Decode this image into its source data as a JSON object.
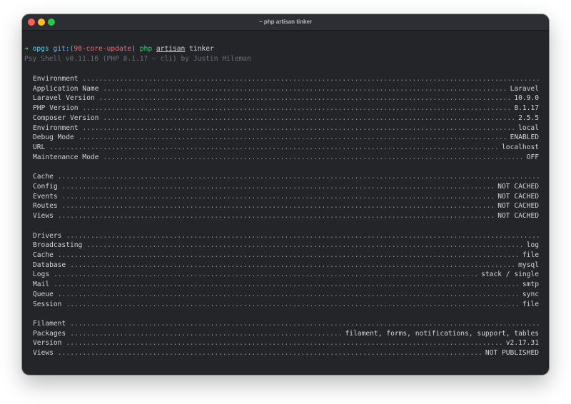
{
  "window": {
    "title": "~ php artisan tinker"
  },
  "prompt_line": {
    "arrow": "➜",
    "dir": "opgs",
    "git_label": "git:",
    "paren_open": "(",
    "branch": "98-core-update",
    "paren_close": ")",
    "php": "php",
    "artisan": "artisan",
    "tinker": "tinker"
  },
  "psy_banner": "Psy Shell v0.11.16 (PHP 8.1.17 — cli) by Justin Hileman",
  "sections": [
    {
      "heading": "Environment",
      "rows": [
        {
          "key": "Application Name",
          "value": "Laravel"
        },
        {
          "key": "Laravel Version",
          "value": "10.9.0"
        },
        {
          "key": "PHP Version",
          "value": "8.1.17"
        },
        {
          "key": "Composer Version",
          "value": "2.5.5"
        },
        {
          "key": "Environment",
          "value": "local"
        },
        {
          "key": "Debug Mode",
          "value": "ENABLED"
        },
        {
          "key": "URL",
          "value": "localhost"
        },
        {
          "key": "Maintenance Mode",
          "value": "OFF"
        }
      ]
    },
    {
      "heading": "Cache",
      "rows": [
        {
          "key": "Config",
          "value": "NOT CACHED"
        },
        {
          "key": "Events",
          "value": "NOT CACHED"
        },
        {
          "key": "Routes",
          "value": "NOT CACHED"
        },
        {
          "key": "Views",
          "value": "NOT CACHED"
        }
      ]
    },
    {
      "heading": "Drivers",
      "rows": [
        {
          "key": "Broadcasting",
          "value": "log"
        },
        {
          "key": "Cache",
          "value": "file"
        },
        {
          "key": "Database",
          "value": "mysql"
        },
        {
          "key": "Logs",
          "value": "stack / single"
        },
        {
          "key": "Mail",
          "value": "smtp"
        },
        {
          "key": "Queue",
          "value": "sync"
        },
        {
          "key": "Session",
          "value": "file"
        }
      ]
    },
    {
      "heading": "Filament",
      "rows": [
        {
          "key": "Packages",
          "value": "filament, forms, notifications, support, tables"
        },
        {
          "key": "Version",
          "value": "v2.17.31"
        },
        {
          "key": "Views",
          "value": "NOT PUBLISHED"
        }
      ]
    }
  ],
  "repl_prompt": ">>>"
}
